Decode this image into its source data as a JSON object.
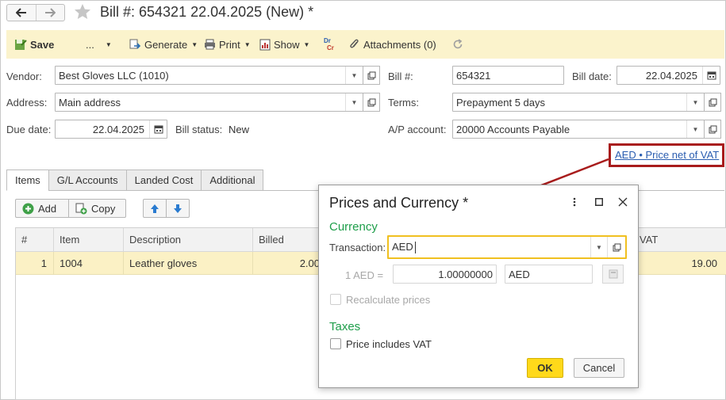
{
  "window": {
    "title": "Bill #: 654321 22.04.2025 (New) *"
  },
  "toolbar": {
    "save_label": "Save",
    "more_label": "...",
    "generate_label": "Generate",
    "print_label": "Print",
    "show_label": "Show",
    "drcr_top": "Dr",
    "drcr_bottom": "Cr",
    "attachments_label": "Attachments (0)"
  },
  "form": {
    "vendor_label": "Vendor:",
    "vendor_value": "Best Gloves LLC (1010)",
    "address_label": "Address:",
    "address_value": "Main address",
    "due_date_label": "Due date:",
    "due_date_value": "22.04.2025",
    "bill_status_label": "Bill status:",
    "bill_status_value": "New",
    "bill_no_label": "Bill #:",
    "bill_no_value": "654321",
    "bill_date_label": "Bill date:",
    "bill_date_value": "22.04.2025",
    "terms_label": "Terms:",
    "terms_value": "Prepayment 5 days",
    "ap_account_label": "A/P account:",
    "ap_account_value": "20000 Accounts Payable",
    "currency_link": "AED • Price net of VAT"
  },
  "tabs": [
    {
      "label": "Items"
    },
    {
      "label": "G/L Accounts"
    },
    {
      "label": "Landed Cost"
    },
    {
      "label": "Additional"
    }
  ],
  "items_toolbar": {
    "add_label": "Add",
    "copy_label": "Copy"
  },
  "table": {
    "headers": [
      "#",
      "Item",
      "Description",
      "Billed",
      "VAT"
    ],
    "rows": [
      {
        "num": "1",
        "item": "1004",
        "description": "Leather gloves",
        "billed": "2.00",
        "vat": "19.00"
      }
    ]
  },
  "dialog": {
    "title": "Prices and Currency *",
    "currency_section": "Currency",
    "transaction_label": "Transaction:",
    "transaction_value": "AED",
    "rate_label": "1 AED =",
    "rate_value": "1.00000000",
    "rate_currency": "AED",
    "recalculate_label": "Recalculate prices",
    "taxes_section": "Taxes",
    "price_includes_vat_label": "Price includes VAT",
    "price_includes_vat_checked": false,
    "recalculate_checked": false,
    "ok_label": "OK",
    "cancel_label": "Cancel"
  },
  "colors": {
    "toolbar_bg": "#fbf3cc",
    "selected_row_bg": "#fbf1c5",
    "section_green": "#1e9e4a",
    "ok_yellow": "#ffd91a",
    "highlight_red": "#a81c1c",
    "link_blue": "#2a5db0",
    "focus_border": "#f0c020"
  }
}
